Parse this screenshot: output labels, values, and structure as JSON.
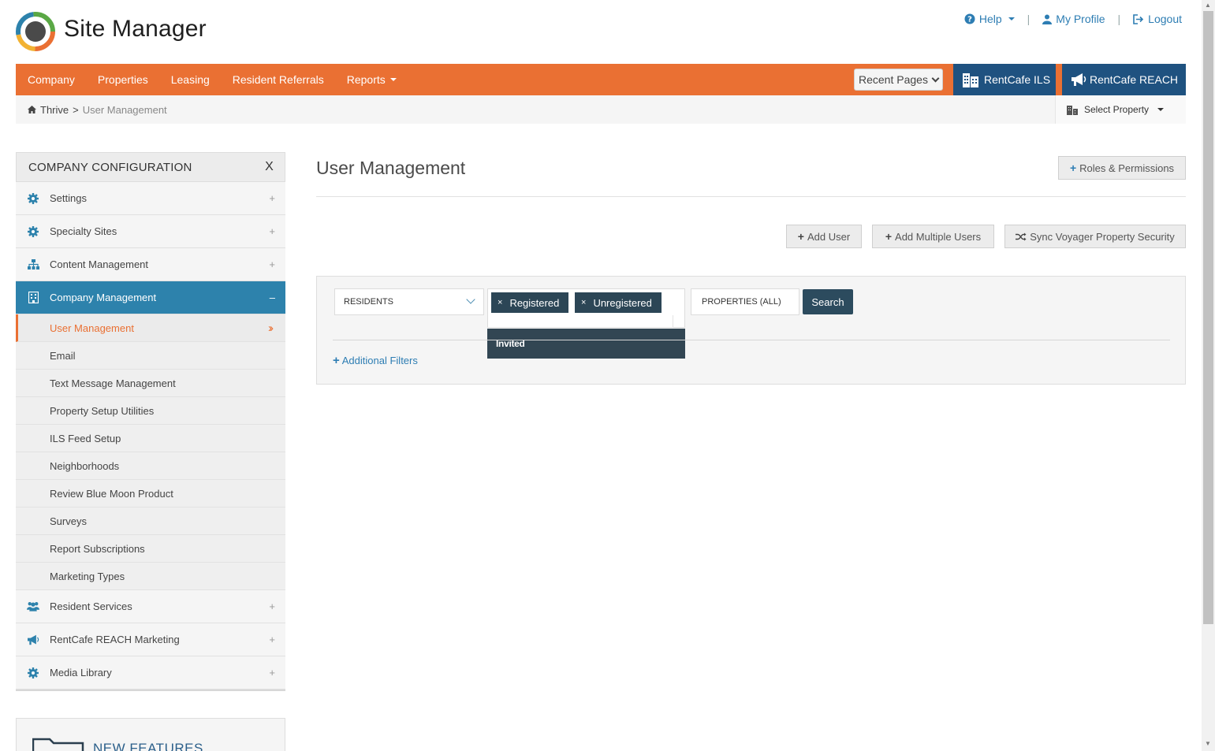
{
  "header": {
    "brand": "Site Manager",
    "help": "Help",
    "my_profile": "My Profile",
    "logout": "Logout",
    "separator": "|"
  },
  "nav": {
    "items": [
      "Company",
      "Properties",
      "Leasing",
      "Resident Referrals",
      "Reports"
    ],
    "recent_pages": "Recent Pages",
    "ils": "RentCafe ILS",
    "reach": "RentCafe REACH"
  },
  "breadcrumb": {
    "root": "Thrive",
    "sep": ">",
    "current": "User Management",
    "select_property": "Select Property"
  },
  "sidebar": {
    "title": "COMPANY CONFIGURATION",
    "close": "X",
    "sections": [
      {
        "label": "Settings",
        "icon": "gear-icon",
        "toggle": "+"
      },
      {
        "label": "Specialty Sites",
        "icon": "gear-icon",
        "toggle": "+"
      },
      {
        "label": "Content Management",
        "icon": "sitemap-icon",
        "toggle": "+"
      },
      {
        "label": "Company Management",
        "icon": "building-icon",
        "toggle": "–"
      },
      {
        "label": "Resident Services",
        "icon": "users-icon",
        "toggle": "+"
      },
      {
        "label": "RentCafe REACH Marketing",
        "icon": "megaphone-icon",
        "toggle": "+"
      },
      {
        "label": "Media Library",
        "icon": "gear-icon",
        "toggle": "+"
      }
    ],
    "company_management_items": [
      "User Management",
      "Email",
      "Text Message Management",
      "Property Setup Utilities",
      "ILS Feed Setup",
      "Neighborhoods",
      "Review Blue Moon Product",
      "Surveys",
      "Report Subscriptions",
      "Marketing Types"
    ],
    "new_features": "NEW FEATURES"
  },
  "main": {
    "title": "User Management",
    "roles_button": "Roles & Permissions",
    "add_user": "Add User",
    "add_multiple": "Add Multiple Users",
    "sync": "Sync Voyager Property Security",
    "filters": {
      "user_type": "RESIDENTS",
      "tags": [
        "Registered",
        "Unregistered"
      ],
      "tag_remove": "×",
      "dropdown_option": "Invited",
      "properties": "PROPERTIES (ALL)",
      "search": "Search",
      "additional": "Additional Filters"
    }
  },
  "colors": {
    "nav_orange": "#ea7033",
    "nav_blue": "#1f5280",
    "active_blue": "#2d82ac",
    "tag_dark": "#2c4656",
    "link_blue": "#2d7db3"
  }
}
